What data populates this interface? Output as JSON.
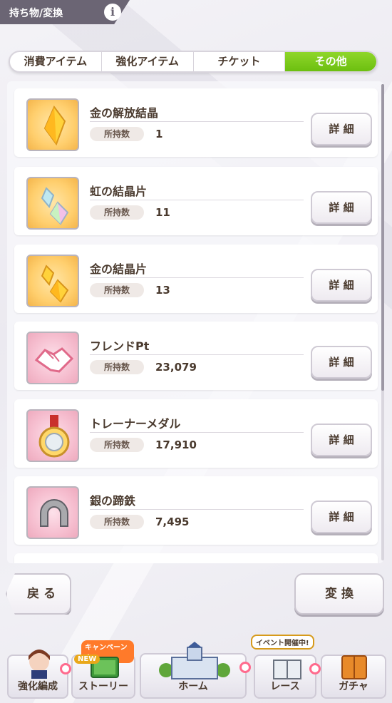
{
  "header": {
    "title": "持ち物/変換",
    "info_icon": "i"
  },
  "tabs": [
    {
      "label": "消費アイテム",
      "active": false
    },
    {
      "label": "強化アイテム",
      "active": false
    },
    {
      "label": "チケット",
      "active": false
    },
    {
      "label": "その他",
      "active": true
    }
  ],
  "items": [
    {
      "name": "金の解放結晶",
      "count_label": "所持数",
      "count": "1",
      "icon": "gold-crystal-icon",
      "bg": "orange",
      "detail_label": "詳 細"
    },
    {
      "name": "虹の結晶片",
      "count_label": "所持数",
      "count": "11",
      "icon": "rainbow-shard-icon",
      "bg": "orange",
      "detail_label": "詳 細"
    },
    {
      "name": "金の結晶片",
      "count_label": "所持数",
      "count": "13",
      "icon": "gold-shard-icon",
      "bg": "orange",
      "detail_label": "詳 細"
    },
    {
      "name": "フレンドPt",
      "count_label": "所持数",
      "count": "23,079",
      "icon": "handshake-icon",
      "bg": "pink",
      "detail_label": "詳 細"
    },
    {
      "name": "トレーナーメダル",
      "count_label": "所持数",
      "count": "17,910",
      "icon": "medal-icon",
      "bg": "pink",
      "detail_label": "詳 細"
    },
    {
      "name": "銀の蹄鉄",
      "count_label": "所持数",
      "count": "7,495",
      "icon": "horseshoe-icon",
      "bg": "pink",
      "detail_label": "詳 細"
    }
  ],
  "buttons": {
    "back": "戻 る",
    "exchange": "変 換"
  },
  "nav": [
    {
      "label": "強化編成",
      "icon": "character-icon"
    },
    {
      "label": "ストーリー",
      "icon": "book-icon",
      "badge_top": "キャンペーン中",
      "badge_new": "NEW"
    },
    {
      "label": "ホーム",
      "icon": "school-building-icon"
    },
    {
      "label": "レース",
      "icon": "race-icon",
      "badge_top": "イベント開催中!"
    },
    {
      "label": "ガチャ",
      "icon": "gacha-icon"
    }
  ],
  "colors": {
    "active_tab": "#7ccb1c",
    "header_bg": "#6b6574",
    "notify": "#ff6a8d"
  }
}
